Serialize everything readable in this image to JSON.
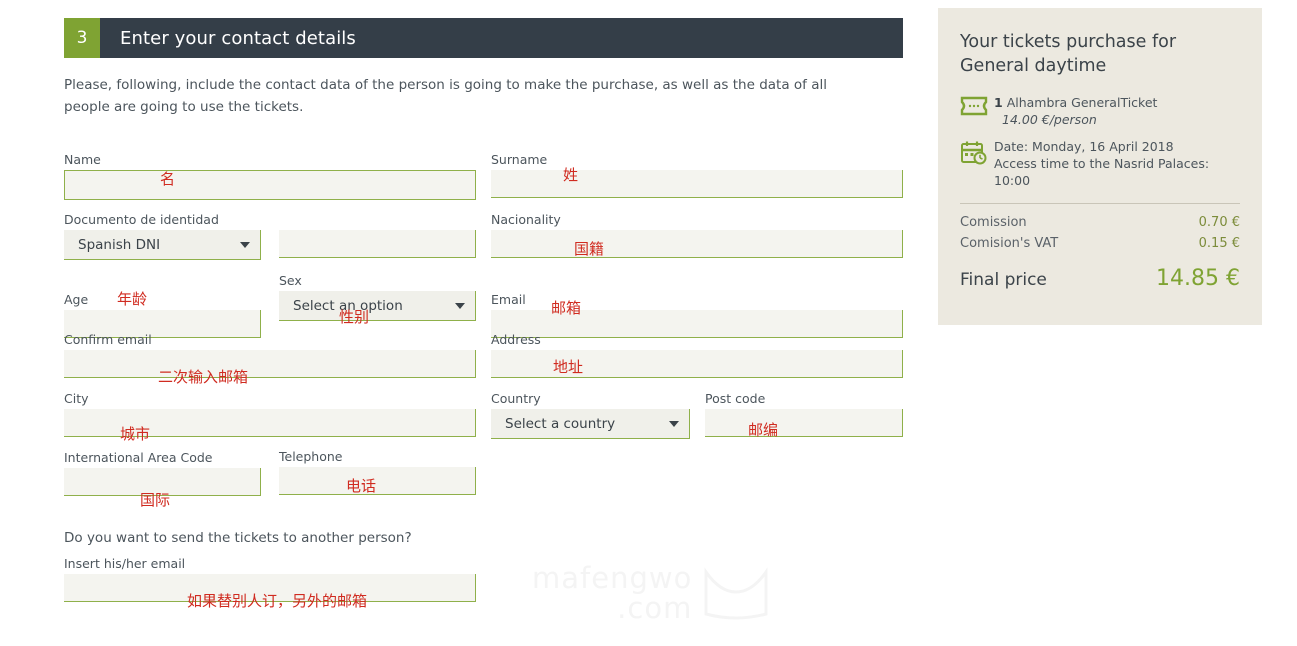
{
  "step": {
    "number": "3",
    "title": "Enter your contact details"
  },
  "intro": "Please, following, include the contact data of the person is going to make the purchase, as well as the data of all people are going to use the tickets.",
  "form": {
    "name": {
      "label": "Name",
      "value": "",
      "placeholder": ""
    },
    "surname": {
      "label": "Surname",
      "value": "",
      "placeholder": ""
    },
    "document_type": {
      "label": "Documento de identidad",
      "value": "Spanish DNI"
    },
    "document_number": {
      "label": "",
      "value": "",
      "placeholder": ""
    },
    "nationality": {
      "label": "Nacionality",
      "value": "",
      "placeholder": ""
    },
    "age": {
      "label": "Age",
      "value": "",
      "placeholder": ""
    },
    "sex": {
      "label": "Sex",
      "value": "Select an option"
    },
    "email": {
      "label": "Email",
      "value": "",
      "placeholder": ""
    },
    "confirm_email": {
      "label": "Confirm email",
      "value": "",
      "placeholder": ""
    },
    "address": {
      "label": "Address",
      "value": "",
      "placeholder": ""
    },
    "city": {
      "label": "City",
      "value": "",
      "placeholder": ""
    },
    "country": {
      "label": "Country",
      "value": "Select a country"
    },
    "post_code": {
      "label": "Post code",
      "value": "",
      "placeholder": ""
    },
    "area_code": {
      "label": "International Area Code",
      "value": "",
      "placeholder": ""
    },
    "telephone": {
      "label": "Telephone",
      "value": "",
      "placeholder": ""
    },
    "send_question": "Do you want to send the tickets to another person?",
    "other_email": {
      "label": "Insert his/her email",
      "value": "",
      "placeholder": ""
    }
  },
  "annotations": {
    "name": "名",
    "surname": "姓",
    "nationality": "国籍",
    "age": "年龄",
    "sex": "性别",
    "email": "邮箱",
    "confirm_email": "二次输入邮箱",
    "address": "地址",
    "city": "城市",
    "post_code": "邮编",
    "area_code": "国际",
    "telephone": "电话",
    "other_email": "如果替别人订，另外的邮箱"
  },
  "sidebar": {
    "title": "Your tickets purchase for General daytime",
    "ticket": {
      "quantity": "1",
      "name": "Alhambra GeneralTicket",
      "unit_price": "14.00 €/person"
    },
    "date": {
      "line1": "Date: Monday, 16 April 2018",
      "line2": "Access time to the Nasrid Palaces:",
      "line3": "10:00"
    },
    "charges": [
      {
        "label": "Comission",
        "value": "0.70 €"
      },
      {
        "label": "Comision's VAT",
        "value": "0.15 €"
      }
    ],
    "total": {
      "label": "Final price",
      "value": "14.85 €"
    }
  },
  "watermark": {
    "line1": "mafengwo",
    "line2": ".com"
  },
  "colors": {
    "accent_green": "#7fa333",
    "header_dark": "#343e48",
    "field_border": "#8fb04a",
    "sidebar_bg": "#ece9e0",
    "annotation_red": "#d02b20"
  }
}
